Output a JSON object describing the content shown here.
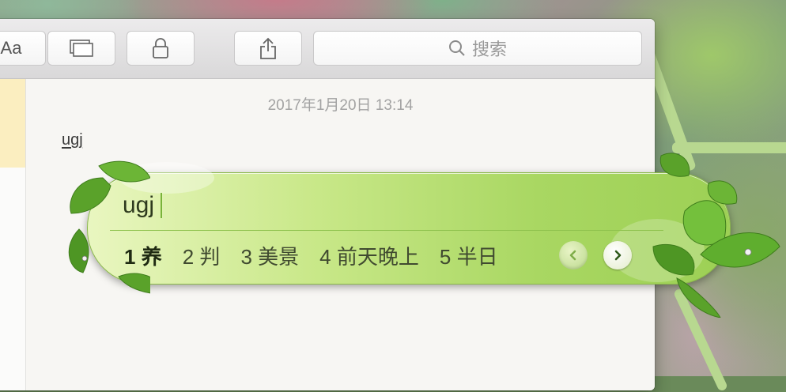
{
  "toolbar": {
    "font_label": "Aa",
    "search_placeholder": "搜索"
  },
  "note": {
    "date": "2017年1月20日 13:14",
    "body": "ugj"
  },
  "ime": {
    "composition": "ugj",
    "candidates": [
      {
        "index": "1",
        "text": "养"
      },
      {
        "index": "2",
        "text": "判"
      },
      {
        "index": "3",
        "text": "美景"
      },
      {
        "index": "4",
        "text": "前天晚上"
      },
      {
        "index": "5",
        "text": "半日"
      }
    ]
  },
  "colors": {
    "ime_gradient_light": "#e9f6c0",
    "ime_gradient_dark": "#9dd055",
    "leaf_green": "#5aa22a",
    "sidebar_selection": "#fbeec0"
  },
  "icons": [
    "font-size-icon",
    "gallery-view-icon",
    "lock-icon",
    "share-icon",
    "search-icon",
    "prev-page-icon",
    "next-page-icon",
    "leaf-decoration"
  ]
}
